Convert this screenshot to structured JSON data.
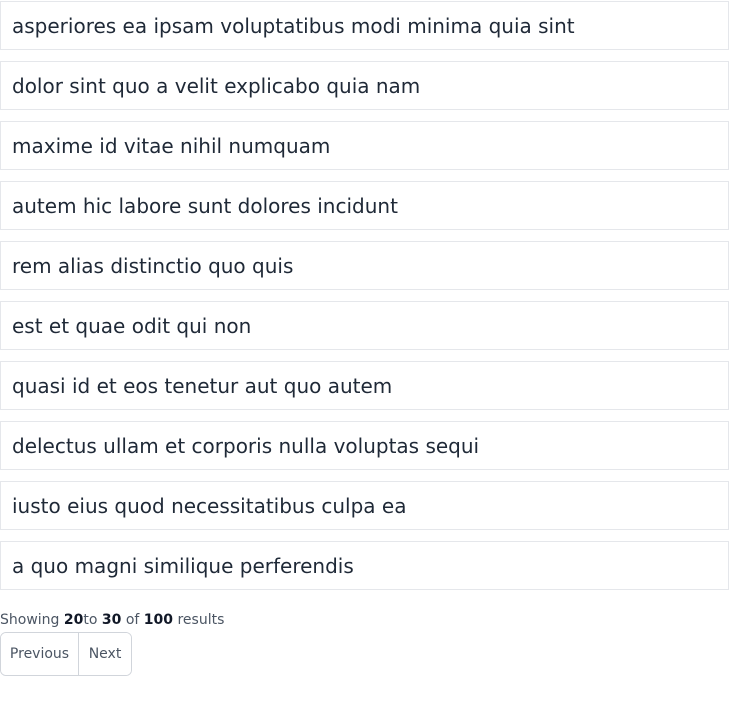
{
  "items": [
    "asperiores ea ipsam voluptatibus modi minima quia sint",
    "dolor sint quo a velit explicabo quia nam",
    "maxime id vitae nihil numquam",
    "autem hic labore sunt dolores incidunt",
    "rem alias distinctio quo quis",
    "est et quae odit qui non",
    "quasi id et eos tenetur aut quo autem",
    "delectus ullam et corporis nulla voluptas sequi",
    "iusto eius quod necessitatibus culpa ea",
    "a quo magni similique perferendis"
  ],
  "pagination": {
    "showing_label": "Showing",
    "from": "20",
    "to_label": "to",
    "to": "30",
    "of_label": "of",
    "total": "100",
    "results_label": "results",
    "previous_label": "Previous",
    "next_label": "Next"
  }
}
